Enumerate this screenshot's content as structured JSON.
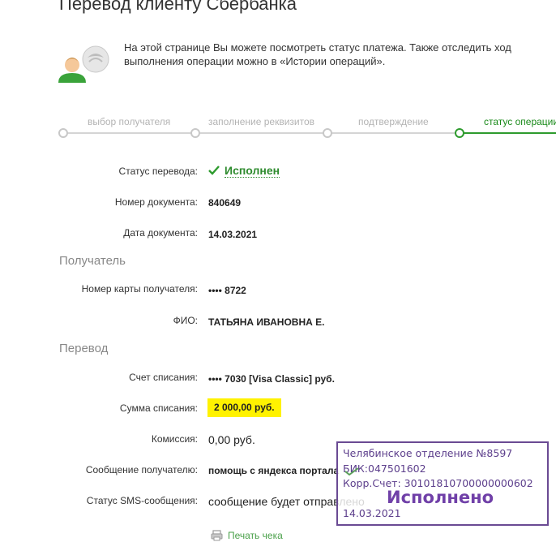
{
  "page": {
    "title": "Перевод клиенту Сбербанка",
    "intro": "На этой странице Вы можете посмотреть статус платежа. Также отследить ход выполнения операции можно в «Истории операций»."
  },
  "steps": [
    {
      "label": "выбор получателя",
      "active": false
    },
    {
      "label": "заполнение реквизитов",
      "active": false
    },
    {
      "label": "подтверждение",
      "active": false
    },
    {
      "label": "статус операции",
      "active": true
    }
  ],
  "details": {
    "status_label": "Статус перевода:",
    "status_value": "Исполнен",
    "doc_number_label": "Номер документа:",
    "doc_number_value": "840649",
    "doc_date_label": "Дата документа:",
    "doc_date_value": "14.03.2021"
  },
  "recipient": {
    "section_title": "Получатель",
    "card_label": "Номер карты получателя:",
    "card_value": "•••• 8722",
    "name_label": "ФИО:",
    "name_value": "ТАТЬЯНА ИВАНОВНА Е."
  },
  "transfer": {
    "section_title": "Перевод",
    "account_label": "Счет списания:",
    "account_value": "•••• 7030  [Visa Classic]  руб.",
    "amount_label": "Сумма списания:",
    "amount_value": "2 000,00  руб.",
    "commission_label": "Комиссия:",
    "commission_value": "0,00 руб.",
    "message_label": "Сообщение получателю:",
    "message_value": "помощь с яндекса портала",
    "sms_label": "Статус SMS-сообщения:",
    "sms_value": "сообщение будет отправлено"
  },
  "print_label": "Печать чека",
  "stamp": {
    "line1": "Челябинское отделение №8597",
    "line2": "БИК:047501602",
    "line3": "Корр.Счет: 30101810700000000602",
    "status": "Исполнено",
    "date": "14.03.2021"
  },
  "colors": {
    "accent_green": "#2e9b2e",
    "highlight_yellow": "#fff200",
    "stamp_purple": "#6a4a93"
  }
}
